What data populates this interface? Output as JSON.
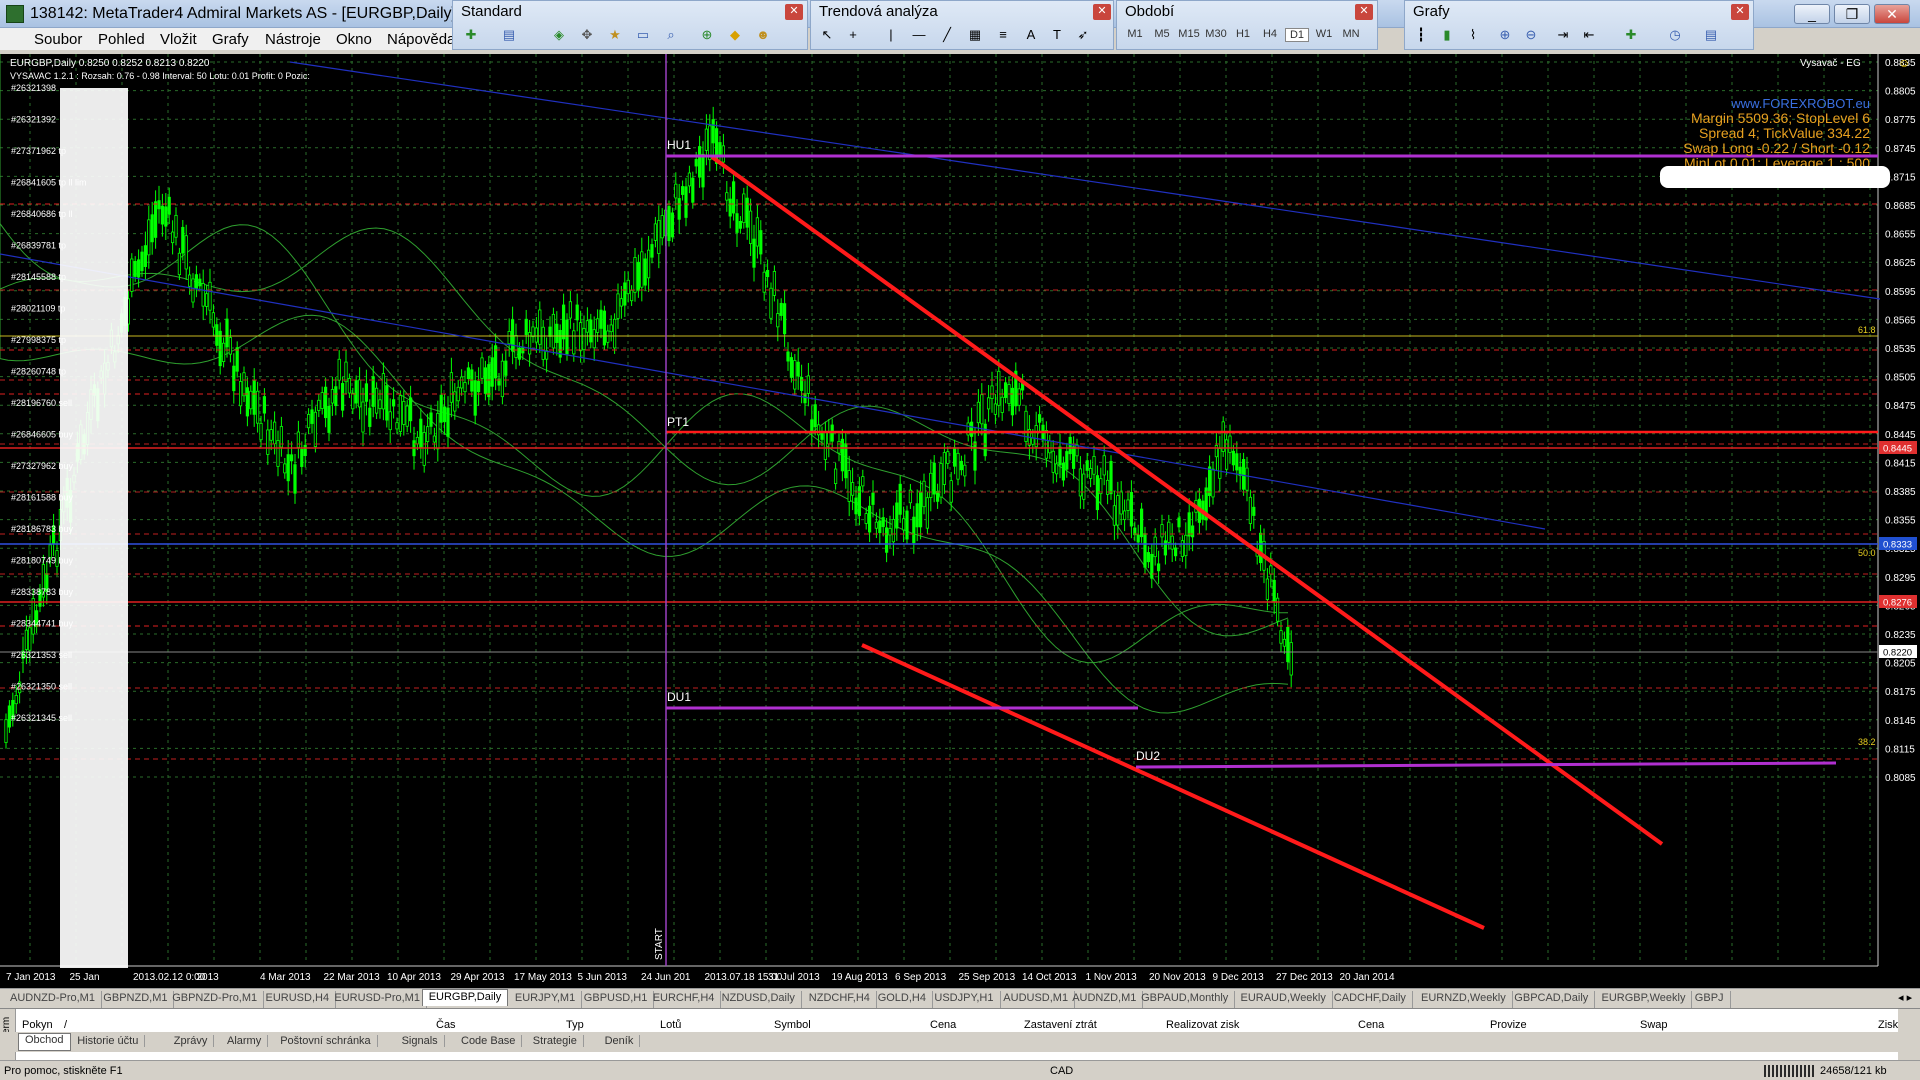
{
  "window": {
    "title": "138142: MetaTrader4 Admiral Markets AS - [EURGBP,Daily]",
    "min": "_",
    "max": "❐",
    "close": "✕"
  },
  "menu": [
    "Soubor",
    "Pohled",
    "Vložit",
    "Grafy",
    "Nástroje",
    "Okno",
    "Nápověda"
  ],
  "toolbars": {
    "standard": {
      "title": "Standard"
    },
    "trend": {
      "title": "Trendová analýza"
    },
    "period": {
      "title": "Období",
      "periods": [
        "M1",
        "M5",
        "M15",
        "M30",
        "H1",
        "H4",
        "D1",
        "W1",
        "MN"
      ]
    },
    "charts": {
      "title": "Grafy"
    }
  },
  "chart": {
    "header": "EURGBP,Daily  0.8250 0.8252 0.8213 0.8220",
    "indicator_line": "VYSAVAC 1.2.1 : Rozsah: 0.76 - 0.98  Interval: 50  Lotu: 0.01  Profit: 0  Pozic:",
    "top_right_label": "Vysavač - EG",
    "info_block": [
      "www.FOREXROBOT.eu",
      "Margin 5509.36; StopLevel 6",
      "Spread 4; TickValue 334.22",
      "Swap Long -0.22 / Short -0.12",
      "MinLot 0.01; Leverage 1 : 500"
    ],
    "price_axis": [
      "0.8835",
      "0.8805",
      "0.8775",
      "0.8745",
      "0.8715",
      "0.8685",
      "0.8655",
      "0.8625",
      "0.8595",
      "0.8565",
      "0.8535",
      "0.8505",
      "0.8475",
      "0.8445",
      "0.8415",
      "0.8385",
      "0.8355",
      "0.8325",
      "0.8295",
      "0.8265",
      "0.8235",
      "0.8205",
      "0.8175",
      "0.8145",
      "0.8115",
      "0.8085"
    ],
    "price_tags": [
      {
        "text": "0.8445",
        "color": "#e03030"
      },
      {
        "text": "0.8333",
        "color": "#2050d0"
      },
      {
        "text": "0.8276",
        "color": "#e03030"
      },
      {
        "text": "0.8220",
        "color": "#ffffff"
      }
    ],
    "fib_labels": [
      "61.8",
      "50.0",
      "38.2"
    ],
    "date_axis": [
      "7 Jan 2013",
      "25 Jan",
      "2013.02.12 0:00",
      "2013",
      "4 Mar 2013",
      "22 Mar 2013",
      "10 Apr 2013",
      "29 Apr 2013",
      "17 May 2013",
      "5 Jun 2013",
      "24 Jun 201",
      "2013.07.18 15:00",
      "31 Jul 2013",
      "19 Aug 2013",
      "6 Sep 2013",
      "25 Sep 2013",
      "14 Oct 2013",
      "1 Nov 2013",
      "20 Nov 2013",
      "9 Dec 2013",
      "27 Dec 2013",
      "20 Jan 2014"
    ],
    "level_labels": [
      "HU1",
      "PT1",
      "DU1",
      "DU2",
      "START"
    ],
    "left_labels": [
      "#26321398",
      "#26321392",
      "#27371962 tp",
      "#26841605 tp ll lim",
      "#26840686 tp ll",
      "#26839781 tp",
      "#28145588 tp",
      "#28021109 tp",
      "#27998375 tp",
      "#28260748 tp",
      "#28196760 sell",
      "#26846605 buy",
      "#27327962 buy",
      "#28161588 buy",
      "#28186783 buy",
      "#28180749 buy",
      "#28338783 buy",
      "#28344741 buy",
      "#26321353 sell",
      "#26321350 sell",
      "#26321345 sell"
    ]
  },
  "symbol_tabs": [
    "AUDNZD-Pro,M1",
    "GBPNZD,M1",
    "GBPNZD-Pro,M1",
    "EURUSD,H4",
    "EURUSD-Pro,M1",
    "EURGBP,Daily",
    "EURJPY,M1",
    "GBPUSD,H1",
    "EURCHF,H4",
    "NZDUSD,Daily",
    "NZDCHF,H4",
    "GOLD,H4",
    "USDJPY,H1",
    "AUDUSD,M1",
    "AUDNZD,M1",
    "GBPAUD,Monthly",
    "EURAUD,Weekly",
    "CADCHF,Daily",
    "EURNZD,Weekly",
    "GBPCAD,Daily",
    "EURGBP,Weekly",
    "GBPJ"
  ],
  "terminal": {
    "side_label": "Term",
    "columns": [
      "Pokyn",
      "/",
      "Čas",
      "Typ",
      "Lotů",
      "Symbol",
      "Cena",
      "Zastavení ztrát",
      "Realizovat zisk",
      "Cena",
      "Provize",
      "Swap",
      "Zisk"
    ],
    "tabs": [
      "Obchod",
      "Historie účtu",
      "Zprávy",
      "Alarmy",
      "Poštovní schránka",
      "Signals",
      "Code Base",
      "Strategie",
      "Deník"
    ]
  },
  "status": {
    "help": "Pro pomoc, stiskněte F1",
    "profile": "CAD",
    "traffic": "24658/121 kb"
  },
  "colors": {
    "candle": "#00ff00",
    "bg": "#000000",
    "trend": "#ff1a1a",
    "level": "#b030d0",
    "grid": "#2a6b2a"
  }
}
